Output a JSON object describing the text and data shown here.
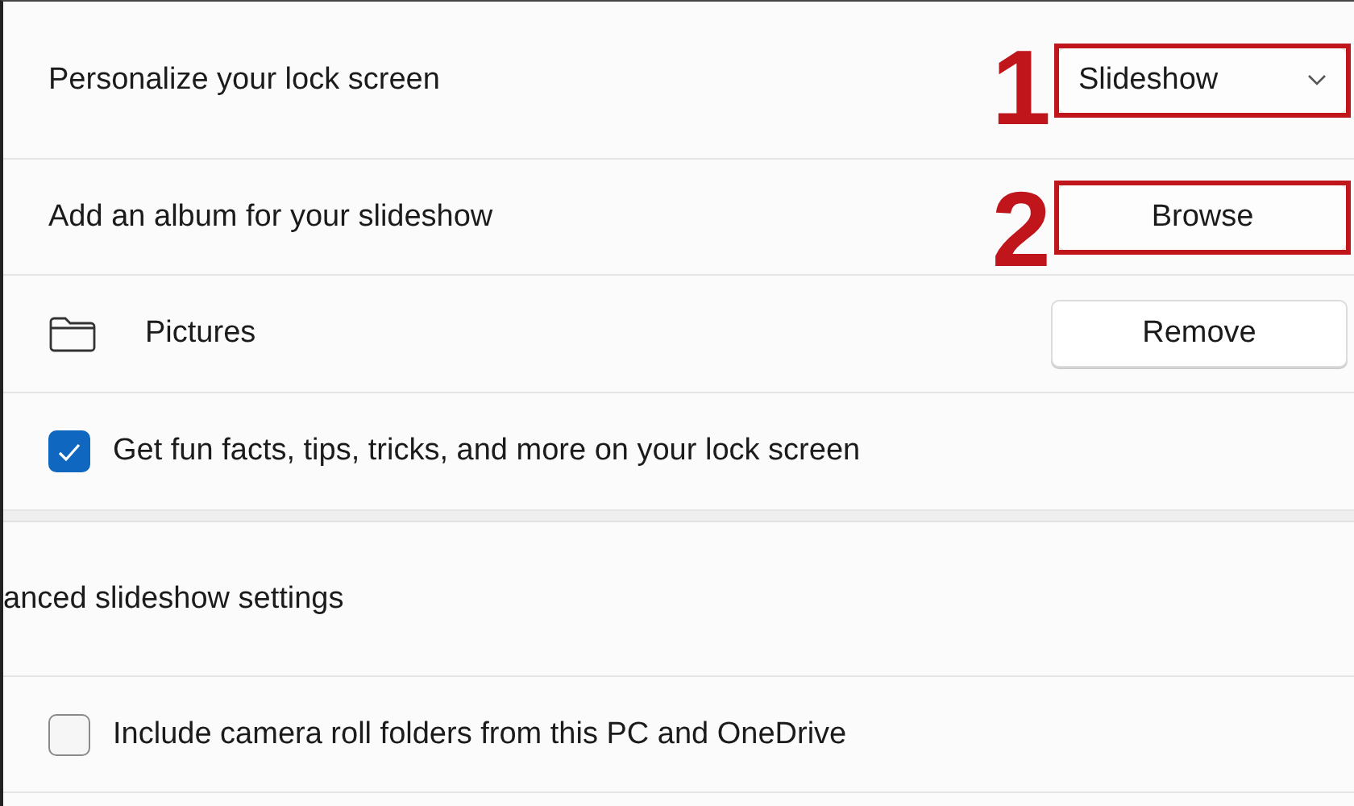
{
  "lock_screen": {
    "label": "Personalize your lock screen",
    "dropdown": {
      "value": "Slideshow"
    },
    "annotation": "1"
  },
  "album": {
    "label": "Add an album for your slideshow",
    "button": "Browse",
    "annotation": "2"
  },
  "folders": [
    {
      "name": "Pictures",
      "button": "Remove"
    }
  ],
  "fun_facts": {
    "label": "Get fun facts, tips, tricks, and more on your lock screen",
    "checked": true
  },
  "advanced": {
    "title": "anced slideshow settings"
  },
  "camera_roll": {
    "label": "Include camera roll folders from this PC and OneDrive",
    "checked": false
  }
}
